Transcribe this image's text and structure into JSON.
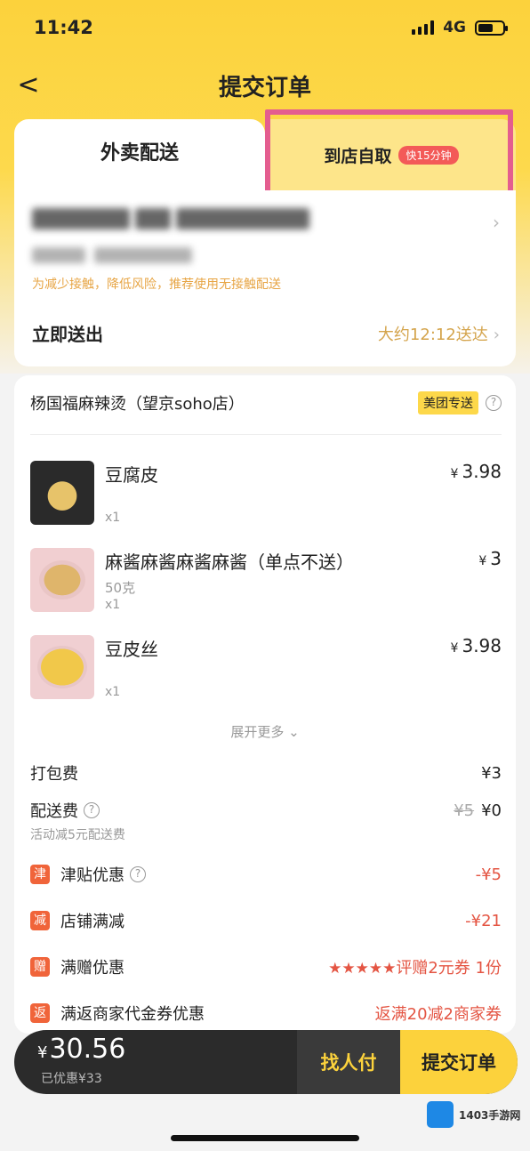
{
  "status": {
    "time": "11:42",
    "network": "4G"
  },
  "nav": {
    "title": "提交订单",
    "back": "<"
  },
  "tabs": {
    "delivery": "外卖配送",
    "pickup": "到店自取",
    "pickup_badge": "快15分钟"
  },
  "address": {
    "tip": "为减少接触，降低风险，推荐使用无接触配送",
    "deliver_label": "立即送出",
    "deliver_time": "大约12:12送达",
    "arrow": "›"
  },
  "shop": {
    "name": "杨国福麻辣烫（望京soho店）",
    "badge": "美团专送",
    "help": "?"
  },
  "items": [
    {
      "name": "豆腐皮",
      "sub": "",
      "qty": "x1",
      "currency": "¥",
      "price": "3.98"
    },
    {
      "name": "麻酱麻酱麻酱麻酱（单点不送）",
      "sub": "50克",
      "qty": "x1",
      "currency": "¥",
      "price": "3"
    },
    {
      "name": "豆皮丝",
      "sub": "",
      "qty": "x1",
      "currency": "¥",
      "price": "3.98"
    }
  ],
  "expand": "展开更多 ⌄",
  "fees": {
    "packing_label": "打包费",
    "packing_value": "¥3",
    "delivery_label": "配送费",
    "delivery_old": "¥5",
    "delivery_value": "¥0",
    "delivery_note": "活动减5元配送费",
    "subsidy_icon": "津",
    "subsidy_label": "津贴优惠",
    "subsidy_value": "-¥5",
    "reduce_icon": "减",
    "reduce_label": "店铺满减",
    "reduce_value": "-¥21",
    "gift_icon": "赠",
    "gift_label": "满赠优惠",
    "gift_stars": "★★★★★",
    "gift_value": "评赠2元券 1份",
    "return_icon": "返",
    "return_label": "满返商家代金券优惠",
    "return_value": "返满20减2商家券"
  },
  "bottom": {
    "currency": "¥",
    "total": "30.56",
    "saved": "已优惠¥33",
    "friend_pay": "找人付",
    "submit": "提交订单"
  },
  "watermark": {
    "text": "1403手游网"
  }
}
